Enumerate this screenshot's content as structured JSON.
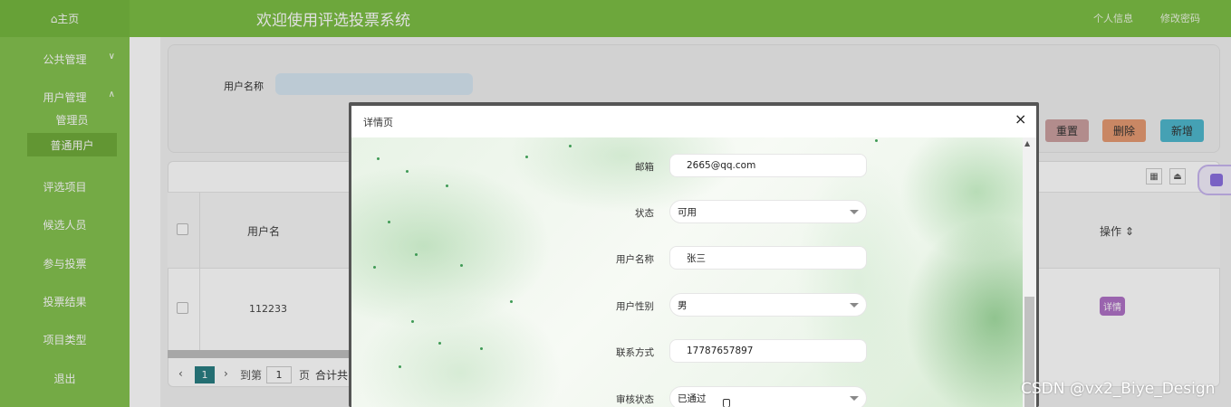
{
  "header": {
    "home": "⌂主页",
    "title": "欢迎使用评选投票系统",
    "profile_link": "个人信息",
    "password_link": "修改密码"
  },
  "sidebar": {
    "items": [
      {
        "label": "公共管理"
      },
      {
        "label": "用户管理"
      },
      {
        "label": "评选项目"
      },
      {
        "label": "候选人员"
      },
      {
        "label": "参与投票"
      },
      {
        "label": "投票结果"
      },
      {
        "label": "项目类型"
      },
      {
        "label": "退出"
      }
    ],
    "sub_items": [
      {
        "label": "管理员"
      },
      {
        "label": "普通用户"
      }
    ]
  },
  "search": {
    "label": "用户名称"
  },
  "buttons": {
    "reset": "重置",
    "delete": "删除",
    "add": "新增"
  },
  "table": {
    "col_username": "用户名",
    "col_actions": "操作 ⇕",
    "row_username": "112233",
    "row_action": "详情"
  },
  "pager": {
    "current": "1",
    "goto_label": "到第",
    "goto_value": "1",
    "page_suffix": "页",
    "total_label": "合计共"
  },
  "modal": {
    "title": "详情页",
    "close": "×",
    "fields": {
      "email_label": "邮箱",
      "email_value": "2665@qq.com",
      "status_label": "状态",
      "status_value": "可用",
      "name_label": "用户名称",
      "name_value": "张三",
      "gender_label": "用户性别",
      "gender_value": "男",
      "phone_label": "联系方式",
      "phone_value": "17787657897",
      "audit_label": "审核状态",
      "audit_value": "已通过"
    }
  },
  "watermark": "CSDN @vx2_Biye_Design",
  "colors": {
    "topbar": "#7dbf45",
    "sidebar": "#84c24f",
    "reset_btn": "#cba0a0",
    "delete_btn": "#e59a72",
    "add_btn": "#4fb8cd",
    "detail_tag": "#b072c7"
  }
}
